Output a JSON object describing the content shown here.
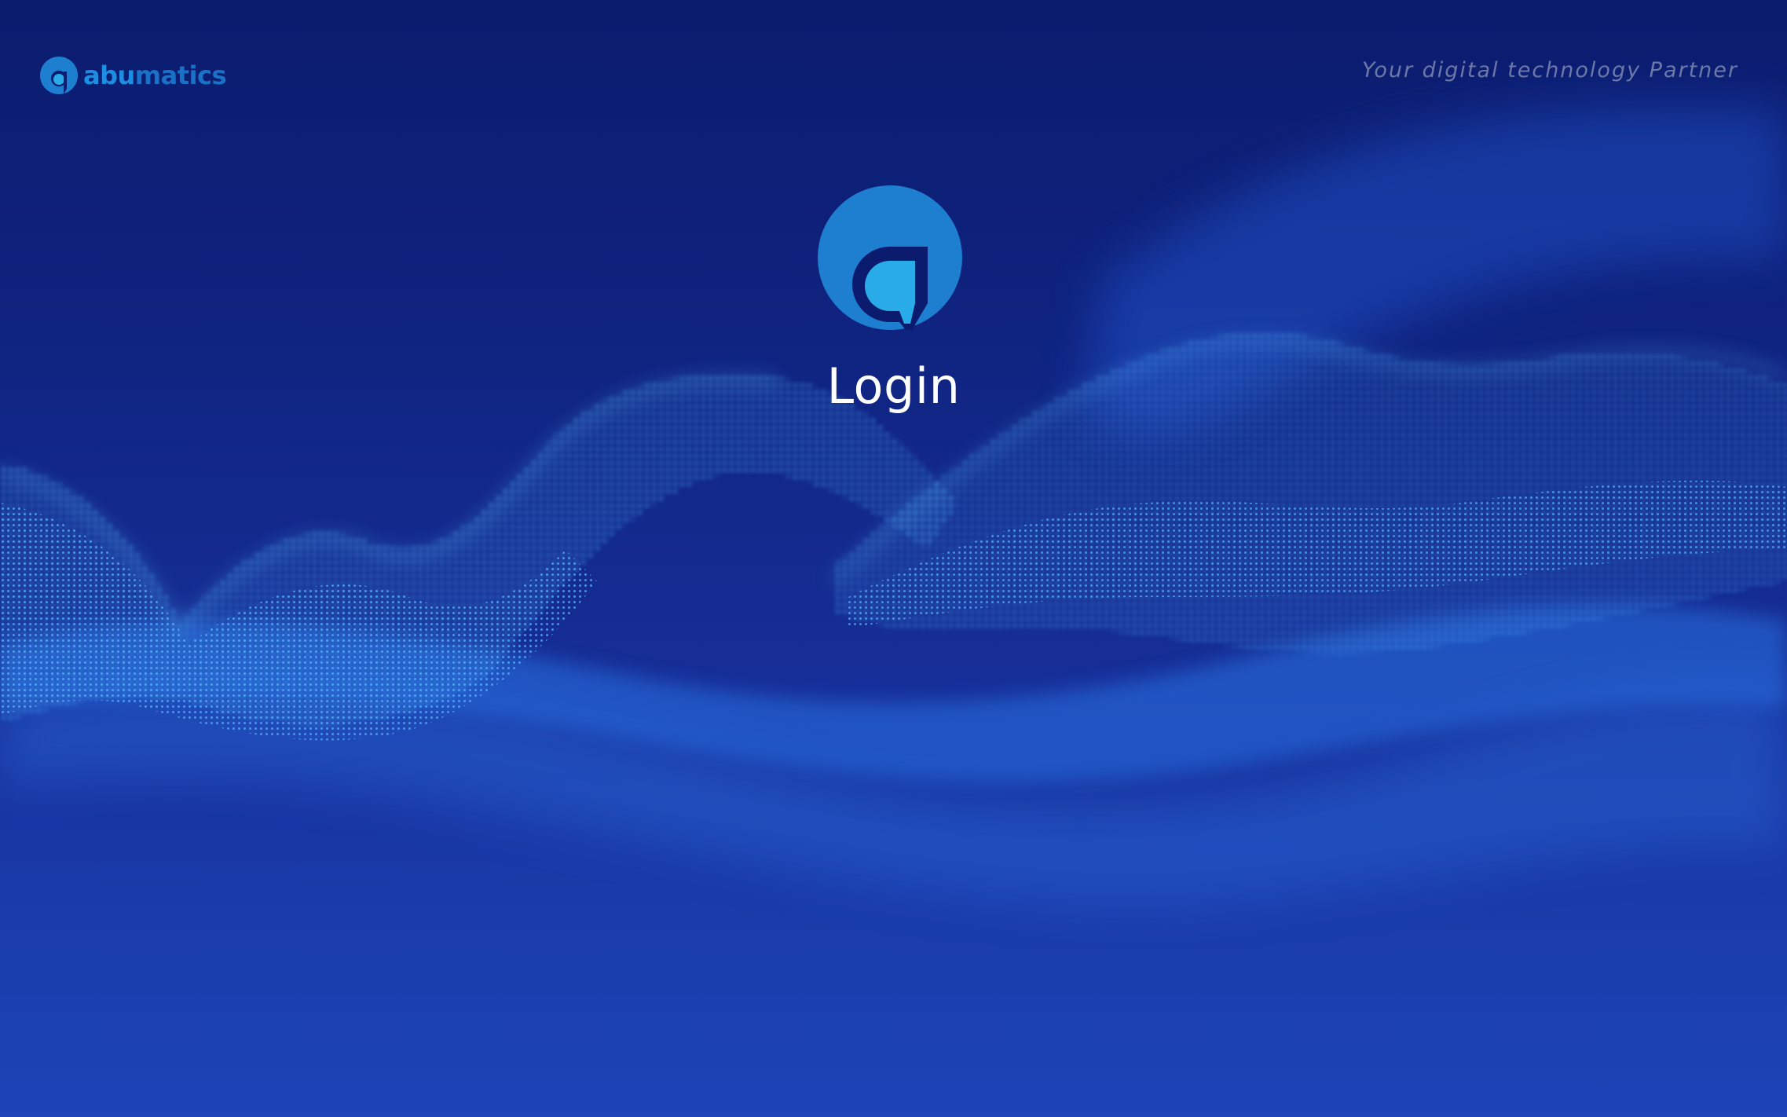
{
  "brand": {
    "name_part1": "abu",
    "name_part2": "matics",
    "logo_icon": "abumatics-a-logo-icon"
  },
  "header": {
    "tagline": "Your digital technology Partner"
  },
  "login": {
    "title": "Login",
    "logo_icon": "abumatics-a-logo-icon"
  },
  "colors": {
    "background_top": "#0b1c6e",
    "background_bottom": "#1d3eaa",
    "brand_blue": "#1d8ee0",
    "logo_circle": "#1e7fd0",
    "logo_accent": "#29abe8"
  }
}
